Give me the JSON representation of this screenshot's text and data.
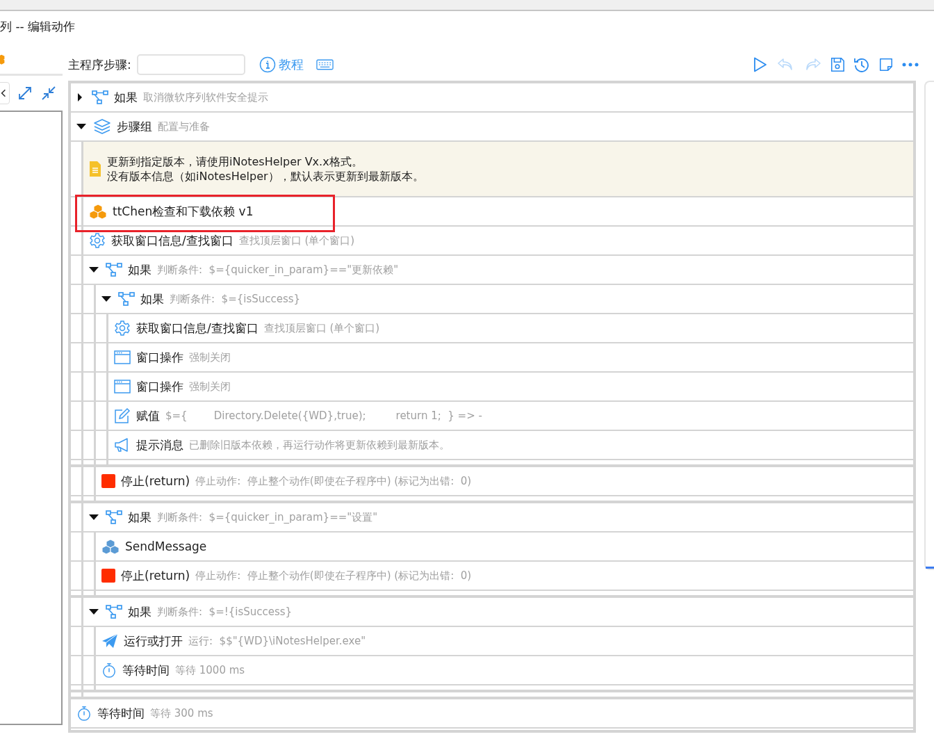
{
  "window": {
    "title": "列 -- 编辑动作"
  },
  "toolbar": {
    "label": "主程序步骤:",
    "tutorial": "教程",
    "buttons": [
      {
        "kind": "run",
        "disabled": false
      },
      {
        "kind": "undo",
        "disabled": true
      },
      {
        "kind": "redo",
        "disabled": true
      },
      {
        "kind": "save",
        "disabled": false
      },
      {
        "kind": "history",
        "disabled": false
      },
      {
        "kind": "note",
        "disabled": false
      },
      {
        "kind": "more",
        "disabled": false
      }
    ]
  },
  "steps": [
    {
      "kind": "if",
      "title": "如果",
      "detail": "取消微软序列软件安全提示",
      "expanded": false
    },
    {
      "kind": "group",
      "title": "步骤组",
      "detail": "配置与准备",
      "expanded": true,
      "children": [
        {
          "kind": "note",
          "lines": [
            "更新到指定版本，请使用iNotesHelper Vx.x格式。",
            "没有版本信息（如iNotesHelper），默认表示更新到最新版本。"
          ]
        },
        {
          "kind": "subprogram",
          "title": "ttChen检查和下载依赖 v1",
          "color": "#f59a0c",
          "highlighted": true
        },
        {
          "kind": "find-window",
          "title": "获取窗口信息/查找窗口",
          "detail": "查找顶层窗口 (单个窗口)"
        },
        {
          "kind": "if",
          "title": "如果",
          "detail": "判断条件:  $={quicker_in_param}==\"更新依赖\"",
          "expanded": true,
          "children": [
            {
              "kind": "if",
              "title": "如果",
              "detail": "判断条件:  $={isSuccess}",
              "expanded": true,
              "children": [
                {
                  "kind": "find-window",
                  "title": "获取窗口信息/查找窗口",
                  "detail": "查找顶层窗口 (单个窗口)"
                },
                {
                  "kind": "window-op",
                  "title": "窗口操作",
                  "detail": "强制关闭"
                },
                {
                  "kind": "window-op",
                  "title": "窗口操作",
                  "detail": "强制关闭"
                },
                {
                  "kind": "assign",
                  "title": "赋值",
                  "detail": "$={        Directory.Delete({WD},true);         return 1;  } => -"
                },
                {
                  "kind": "message",
                  "title": "提示消息",
                  "detail": "已删除旧版本依赖，再运行动作将更新依赖到最新版本。"
                }
              ]
            },
            {
              "kind": "stop",
              "title": "停止(return)",
              "detail": "停止动作:  停止整个动作(即使在子程序中) (标记为出错:  0)"
            }
          ]
        },
        {
          "kind": "if",
          "title": "如果",
          "detail": "判断条件:  $={quicker_in_param}==\"设置\"",
          "expanded": true,
          "children": [
            {
              "kind": "subprogram",
              "title": "SendMessage",
              "color": "#5b9bd5",
              "highlighted": false
            },
            {
              "kind": "stop",
              "title": "停止(return)",
              "detail": "停止动作:  停止整个动作(即使在子程序中) (标记为出错:  0)"
            }
          ]
        },
        {
          "kind": "if",
          "title": "如果",
          "detail": "判断条件:  $=!{isSuccess}",
          "expanded": true,
          "children": [
            {
              "kind": "run",
              "title": "运行或打开",
              "detail": "运行:  $$\"{WD}\\iNotesHelper.exe\""
            },
            {
              "kind": "wait",
              "title": "等待时间",
              "detail": "等待 1000 ms"
            }
          ]
        }
      ]
    },
    {
      "kind": "wait",
      "title": "等待时间",
      "detail": "等待 300 ms"
    }
  ]
}
